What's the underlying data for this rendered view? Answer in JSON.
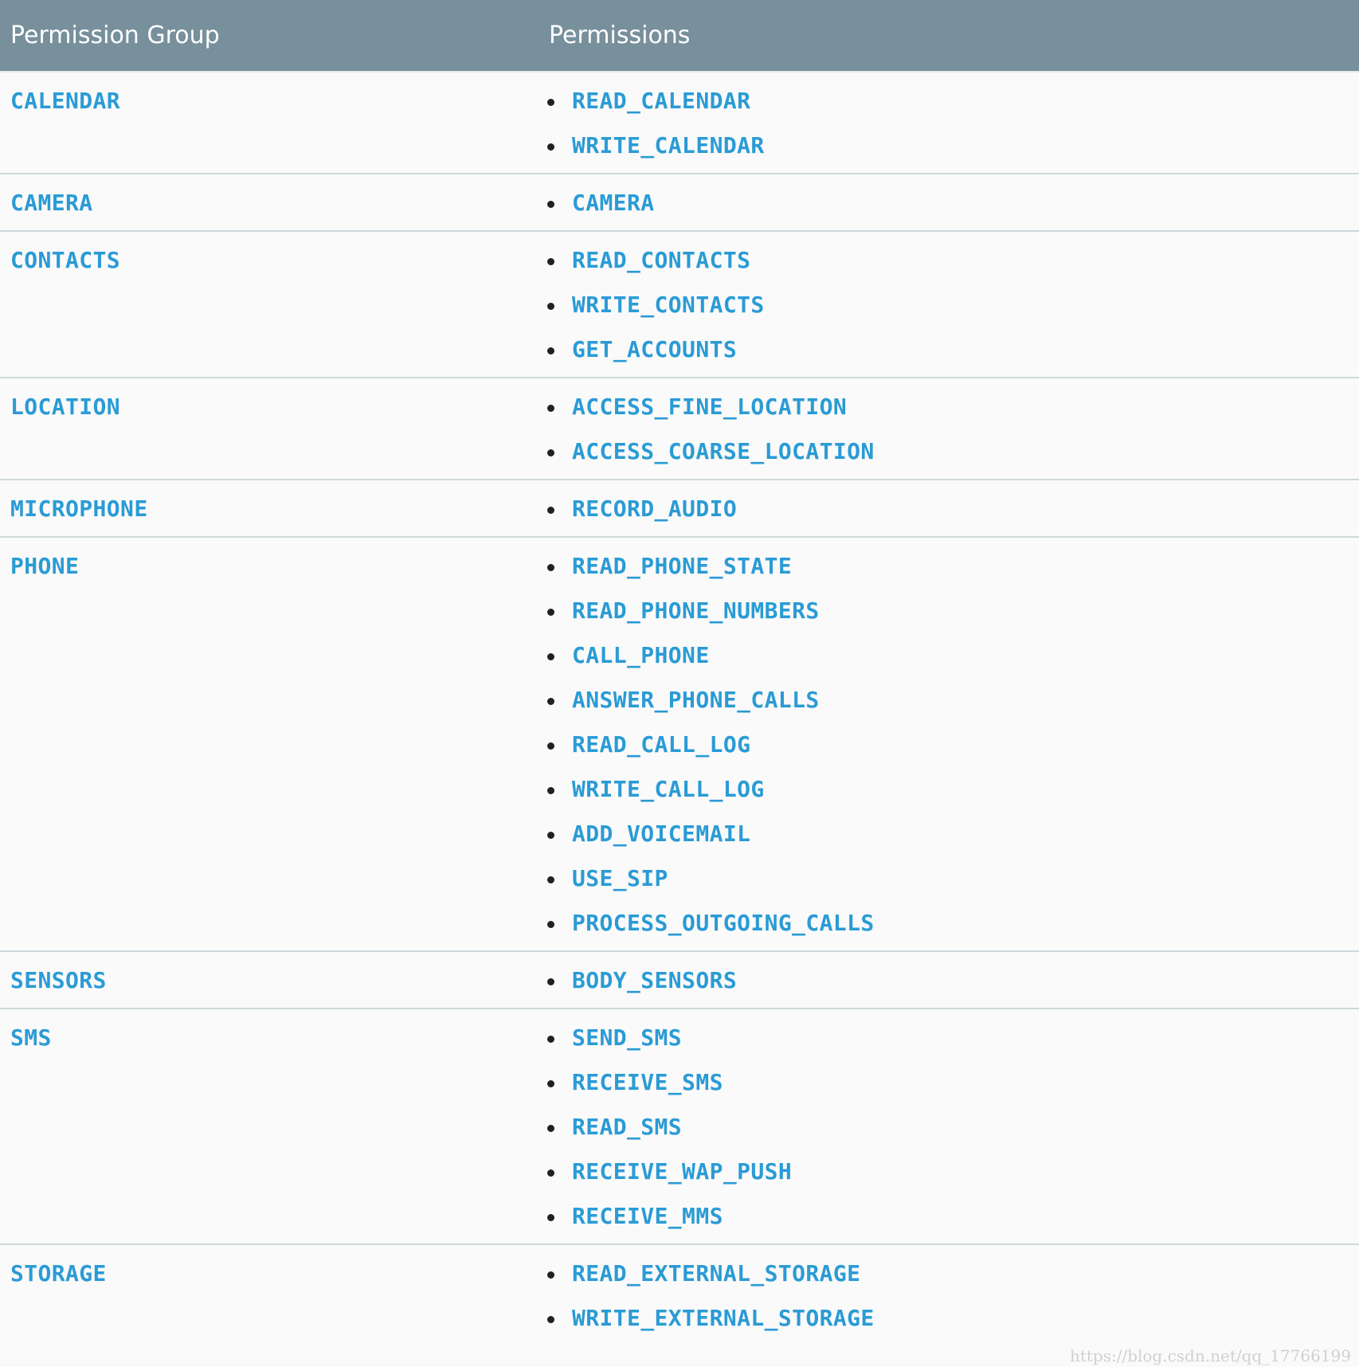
{
  "table": {
    "headers": {
      "group": "Permission Group",
      "permissions": "Permissions"
    },
    "rows": [
      {
        "group": "CALENDAR",
        "permissions": [
          "READ_CALENDAR",
          "WRITE_CALENDAR"
        ]
      },
      {
        "group": "CAMERA",
        "permissions": [
          "CAMERA"
        ]
      },
      {
        "group": "CONTACTS",
        "permissions": [
          "READ_CONTACTS",
          "WRITE_CONTACTS",
          "GET_ACCOUNTS"
        ]
      },
      {
        "group": "LOCATION",
        "permissions": [
          "ACCESS_FINE_LOCATION",
          "ACCESS_COARSE_LOCATION"
        ]
      },
      {
        "group": "MICROPHONE",
        "permissions": [
          "RECORD_AUDIO"
        ]
      },
      {
        "group": "PHONE",
        "permissions": [
          "READ_PHONE_STATE",
          "READ_PHONE_NUMBERS",
          "CALL_PHONE",
          "ANSWER_PHONE_CALLS",
          "READ_CALL_LOG",
          "WRITE_CALL_LOG",
          "ADD_VOICEMAIL",
          "USE_SIP",
          "PROCESS_OUTGOING_CALLS"
        ]
      },
      {
        "group": "SENSORS",
        "permissions": [
          "BODY_SENSORS"
        ]
      },
      {
        "group": "SMS",
        "permissions": [
          "SEND_SMS",
          "RECEIVE_SMS",
          "READ_SMS",
          "RECEIVE_WAP_PUSH",
          "RECEIVE_MMS"
        ]
      },
      {
        "group": "STORAGE",
        "permissions": [
          "READ_EXTERNAL_STORAGE",
          "WRITE_EXTERNAL_STORAGE"
        ]
      }
    ]
  },
  "watermark": "https://blog.csdn.net/qq_17766199",
  "colors": {
    "header_bg": "#78909c",
    "header_text": "#ffffff",
    "link": "#2a9bd5",
    "page_bg": "#fafafa",
    "row_divider": "#cfd8dc"
  }
}
